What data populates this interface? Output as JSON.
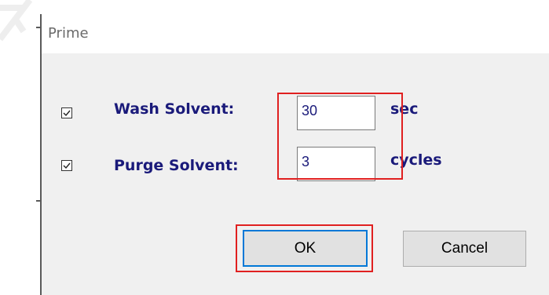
{
  "window": {
    "title": "Prime"
  },
  "options": [
    {
      "label": "Wash Solvent:",
      "checked": true,
      "value": "30",
      "unit": "sec"
    },
    {
      "label": "Purge Solvent:",
      "checked": true,
      "value": "3",
      "unit": "cycles"
    }
  ],
  "buttons": {
    "ok": "OK",
    "cancel": "Cancel"
  },
  "colors": {
    "label": "#1a1a7a",
    "highlight": "#e02020",
    "focus": "#0078d7",
    "client_bg": "#f0f0f0"
  }
}
